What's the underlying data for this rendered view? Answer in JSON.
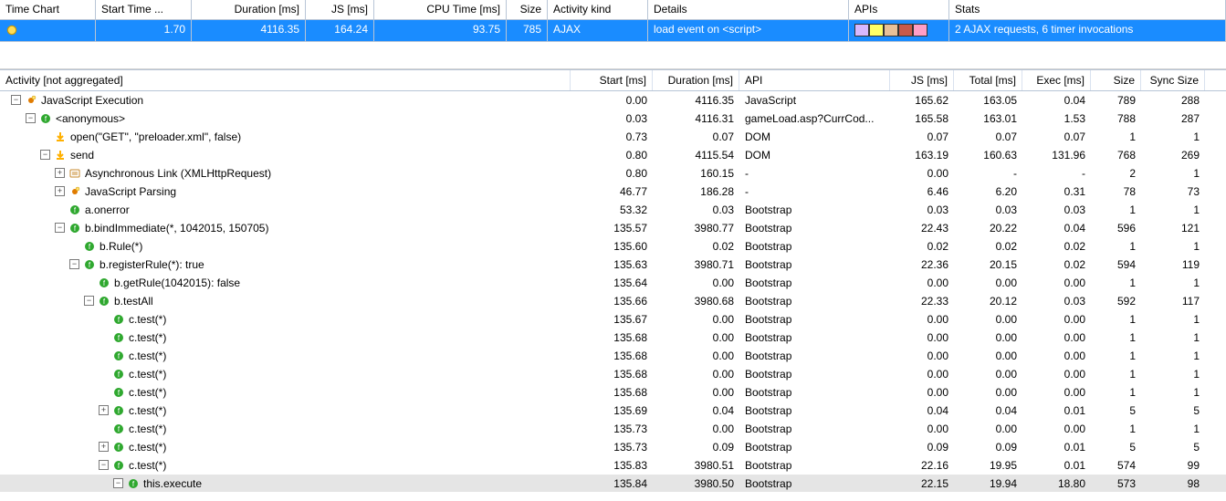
{
  "top": {
    "headers": {
      "time_chart": "Time Chart",
      "start_time": "Start Time ...",
      "duration": "Duration [ms]",
      "js": "JS [ms]",
      "cpu": "CPU Time [ms]",
      "size": "Size",
      "activity_kind": "Activity kind",
      "details": "Details",
      "apis": "APIs",
      "stats": "Stats"
    },
    "row": {
      "start_time": "1.70",
      "duration": "4116.35",
      "js": "164.24",
      "cpu": "93.75",
      "size": "785",
      "activity_kind": "AJAX",
      "details": "load event on <script>",
      "stats": "2 AJAX requests, 6 timer invocations",
      "api_colors": [
        "#d7b8ff",
        "#ffff66",
        "#e8c098",
        "#c85a4a",
        "#ff9ec7"
      ]
    }
  },
  "tree": {
    "headers": {
      "activity": "Activity [not aggregated]",
      "start": "Start [ms]",
      "duration": "Duration [ms]",
      "api": "API",
      "js": "JS [ms]",
      "total": "Total [ms]",
      "exec": "Exec [ms]",
      "size": "Size",
      "sync_size": "Sync Size"
    },
    "rows": [
      {
        "indent": 0,
        "toggle": "minus",
        "icon": "js",
        "label": "JavaScript Execution",
        "start": "0.00",
        "dur": "4116.35",
        "api": "JavaScript",
        "js": "165.62",
        "total": "163.05",
        "exec": "0.04",
        "size": "789",
        "sync": "288"
      },
      {
        "indent": 1,
        "toggle": "minus",
        "icon": "fn",
        "label": "<anonymous>",
        "start": "0.03",
        "dur": "4116.31",
        "api": "gameLoad.asp?CurrCod...",
        "js": "165.58",
        "total": "163.01",
        "exec": "1.53",
        "size": "788",
        "sync": "287"
      },
      {
        "indent": 2,
        "toggle": "none",
        "icon": "arrow",
        "label": "open(\"GET\", \"preloader.xml\", false)",
        "start": "0.73",
        "dur": "0.07",
        "api": "DOM",
        "js": "0.07",
        "total": "0.07",
        "exec": "0.07",
        "size": "1",
        "sync": "1"
      },
      {
        "indent": 2,
        "toggle": "minus",
        "icon": "arrow",
        "label": "send",
        "start": "0.80",
        "dur": "4115.54",
        "api": "DOM",
        "js": "163.19",
        "total": "160.63",
        "exec": "131.96",
        "size": "768",
        "sync": "269"
      },
      {
        "indent": 3,
        "toggle": "plus",
        "icon": "link",
        "label": "Asynchronous Link (XMLHttpRequest)",
        "start": "0.80",
        "dur": "160.15",
        "api": "-",
        "js": "0.00",
        "total": "-",
        "exec": "-",
        "size": "2",
        "sync": "1"
      },
      {
        "indent": 3,
        "toggle": "plus",
        "icon": "js",
        "label": "JavaScript Parsing",
        "start": "46.77",
        "dur": "186.28",
        "api": "-",
        "js": "6.46",
        "total": "6.20",
        "exec": "0.31",
        "size": "78",
        "sync": "73"
      },
      {
        "indent": 3,
        "toggle": "none",
        "icon": "fn",
        "label": "a.onerror",
        "start": "53.32",
        "dur": "0.03",
        "api": "Bootstrap",
        "js": "0.03",
        "total": "0.03",
        "exec": "0.03",
        "size": "1",
        "sync": "1"
      },
      {
        "indent": 3,
        "toggle": "minus",
        "icon": "fn",
        "label": "b.bindImmediate(*, 1042015, 150705)",
        "start": "135.57",
        "dur": "3980.77",
        "api": "Bootstrap",
        "js": "22.43",
        "total": "20.22",
        "exec": "0.04",
        "size": "596",
        "sync": "121"
      },
      {
        "indent": 4,
        "toggle": "none",
        "icon": "fn",
        "label": "b.Rule(*)",
        "start": "135.60",
        "dur": "0.02",
        "api": "Bootstrap",
        "js": "0.02",
        "total": "0.02",
        "exec": "0.02",
        "size": "1",
        "sync": "1"
      },
      {
        "indent": 4,
        "toggle": "minus",
        "icon": "fn",
        "label": "b.registerRule(*): true",
        "start": "135.63",
        "dur": "3980.71",
        "api": "Bootstrap",
        "js": "22.36",
        "total": "20.15",
        "exec": "0.02",
        "size": "594",
        "sync": "119"
      },
      {
        "indent": 5,
        "toggle": "none",
        "icon": "fn",
        "label": "b.getRule(1042015): false",
        "start": "135.64",
        "dur": "0.00",
        "api": "Bootstrap",
        "js": "0.00",
        "total": "0.00",
        "exec": "0.00",
        "size": "1",
        "sync": "1"
      },
      {
        "indent": 5,
        "toggle": "minus",
        "icon": "fn",
        "label": "b.testAll",
        "start": "135.66",
        "dur": "3980.68",
        "api": "Bootstrap",
        "js": "22.33",
        "total": "20.12",
        "exec": "0.03",
        "size": "592",
        "sync": "117"
      },
      {
        "indent": 6,
        "toggle": "none",
        "icon": "fn",
        "label": "c.test(*)",
        "start": "135.67",
        "dur": "0.00",
        "api": "Bootstrap",
        "js": "0.00",
        "total": "0.00",
        "exec": "0.00",
        "size": "1",
        "sync": "1"
      },
      {
        "indent": 6,
        "toggle": "none",
        "icon": "fn",
        "label": "c.test(*)",
        "start": "135.68",
        "dur": "0.00",
        "api": "Bootstrap",
        "js": "0.00",
        "total": "0.00",
        "exec": "0.00",
        "size": "1",
        "sync": "1"
      },
      {
        "indent": 6,
        "toggle": "none",
        "icon": "fn",
        "label": "c.test(*)",
        "start": "135.68",
        "dur": "0.00",
        "api": "Bootstrap",
        "js": "0.00",
        "total": "0.00",
        "exec": "0.00",
        "size": "1",
        "sync": "1"
      },
      {
        "indent": 6,
        "toggle": "none",
        "icon": "fn",
        "label": "c.test(*)",
        "start": "135.68",
        "dur": "0.00",
        "api": "Bootstrap",
        "js": "0.00",
        "total": "0.00",
        "exec": "0.00",
        "size": "1",
        "sync": "1"
      },
      {
        "indent": 6,
        "toggle": "none",
        "icon": "fn",
        "label": "c.test(*)",
        "start": "135.68",
        "dur": "0.00",
        "api": "Bootstrap",
        "js": "0.00",
        "total": "0.00",
        "exec": "0.00",
        "size": "1",
        "sync": "1"
      },
      {
        "indent": 6,
        "toggle": "plus",
        "icon": "fn",
        "label": "c.test(*)",
        "start": "135.69",
        "dur": "0.04",
        "api": "Bootstrap",
        "js": "0.04",
        "total": "0.04",
        "exec": "0.01",
        "size": "5",
        "sync": "5"
      },
      {
        "indent": 6,
        "toggle": "none",
        "icon": "fn",
        "label": "c.test(*)",
        "start": "135.73",
        "dur": "0.00",
        "api": "Bootstrap",
        "js": "0.00",
        "total": "0.00",
        "exec": "0.00",
        "size": "1",
        "sync": "1"
      },
      {
        "indent": 6,
        "toggle": "plus",
        "icon": "fn",
        "label": "c.test(*)",
        "start": "135.73",
        "dur": "0.09",
        "api": "Bootstrap",
        "js": "0.09",
        "total": "0.09",
        "exec": "0.01",
        "size": "5",
        "sync": "5"
      },
      {
        "indent": 6,
        "toggle": "minus",
        "icon": "fn",
        "label": "c.test(*)",
        "start": "135.83",
        "dur": "3980.51",
        "api": "Bootstrap",
        "js": "22.16",
        "total": "19.95",
        "exec": "0.01",
        "size": "574",
        "sync": "99"
      },
      {
        "indent": 7,
        "toggle": "minus",
        "icon": "fn",
        "label": "this.execute",
        "start": "135.84",
        "dur": "3980.50",
        "api": "Bootstrap",
        "js": "22.15",
        "total": "19.94",
        "exec": "18.80",
        "size": "573",
        "sync": "98",
        "selected": true
      }
    ]
  },
  "icons": {
    "js_color": "#e07b00",
    "fn_bg": "#2fa82f",
    "fn_fg": "#fff",
    "arrow_color": "#ffb000",
    "link_color": "#c78a2e"
  }
}
